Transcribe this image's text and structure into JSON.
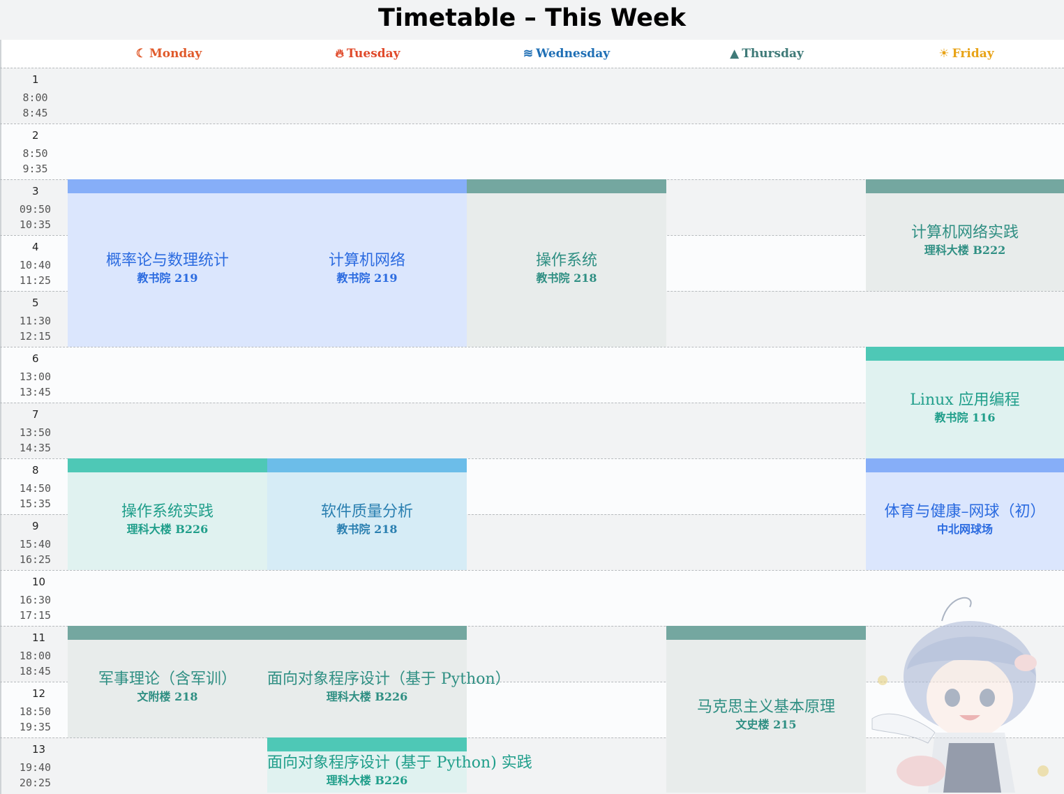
{
  "title": "Timetable – This Week",
  "days": [
    {
      "label": "Monday",
      "icon": "moon-icon",
      "color": "#e05a2b"
    },
    {
      "label": "Tuesday",
      "icon": "flame-icon",
      "color": "#e04a2b"
    },
    {
      "label": "Wednesday",
      "icon": "waves-icon",
      "color": "#1f6fb5"
    },
    {
      "label": "Thursday",
      "icon": "tree-icon",
      "color": "#3f7a78"
    },
    {
      "label": "Friday",
      "icon": "sun-icon",
      "color": "#e8a317"
    }
  ],
  "periods": [
    {
      "num": "1",
      "start": "8:00",
      "end": "8:45"
    },
    {
      "num": "2",
      "start": "8:50",
      "end": "9:35"
    },
    {
      "num": "3",
      "start": "09:50",
      "end": "10:35"
    },
    {
      "num": "4",
      "start": "10:40",
      "end": "11:25"
    },
    {
      "num": "5",
      "start": "11:30",
      "end": "12:15"
    },
    {
      "num": "6",
      "start": "13:00",
      "end": "13:45"
    },
    {
      "num": "7",
      "start": "13:50",
      "end": "14:35"
    },
    {
      "num": "8",
      "start": "14:50",
      "end": "15:35"
    },
    {
      "num": "9",
      "start": "15:40",
      "end": "16:25"
    },
    {
      "num": "10",
      "start": "16:30",
      "end": "17:15"
    },
    {
      "num": "11",
      "start": "18:00",
      "end": "18:45"
    },
    {
      "num": "12",
      "start": "18:50",
      "end": "19:35"
    },
    {
      "num": "13",
      "start": "19:40",
      "end": "20:25"
    }
  ],
  "courses": [
    {
      "name": "概率论与数理统计",
      "room": "教书院 219",
      "bar": "#86aef8",
      "bg": "#dbe6fd",
      "fg": "#2b6be0"
    },
    {
      "name": "计算机网络",
      "room": "教书院 219",
      "bar": "#86aef8",
      "bg": "#dbe6fd",
      "fg": "#2b6be0"
    },
    {
      "name": "操作系统",
      "room": "教书院 218",
      "bar": "#74a7a0",
      "bg": "#e8eceb",
      "fg": "#2f8f83"
    },
    {
      "name": "计算机网络实践",
      "room": "理科大楼 B222",
      "bar": "#74a7a0",
      "bg": "#e8eceb",
      "fg": "#2f8f83"
    },
    {
      "name": "Linux 应用编程",
      "room": "教书院 116",
      "bar": "#4ec8b6",
      "bg": "#e0f2f0",
      "fg": "#1f9e8a"
    },
    {
      "name": "操作系统实践",
      "room": "理科大楼 B226",
      "bar": "#4ec8b6",
      "bg": "#e0f2f0",
      "fg": "#1f9e8a"
    },
    {
      "name": "软件质量分析",
      "room": "教书院 218",
      "bar": "#6cbde9",
      "bg": "#d6ecf6",
      "fg": "#2a7fb0"
    },
    {
      "name": "体育与健康–网球（初）",
      "room": "中北网球场",
      "bar": "#86aef8",
      "bg": "#dbe6fd",
      "fg": "#2b6be0"
    },
    {
      "name": "军事理论（含军训）",
      "room": "文附楼 218",
      "bar": "#74a7a0",
      "bg": "#e8eceb",
      "fg": "#2f8f83"
    },
    {
      "name": "面向对象程序设计（基于 Python）",
      "room": "理科大楼 B226",
      "bar": "#74a7a0",
      "bg": "#e8eceb",
      "fg": "#2f8f83"
    },
    {
      "name": "马克思主义基本原理",
      "room": "文史楼 215",
      "bar": "#74a7a0",
      "bg": "#e8eceb",
      "fg": "#2f8f83"
    },
    {
      "name": "面向对象程序设计 (基于 Python) 实践",
      "room": "理科大楼 B226",
      "bar": "#4ec8b6",
      "bg": "#e0f2f0",
      "fg": "#1f9e8a"
    }
  ]
}
